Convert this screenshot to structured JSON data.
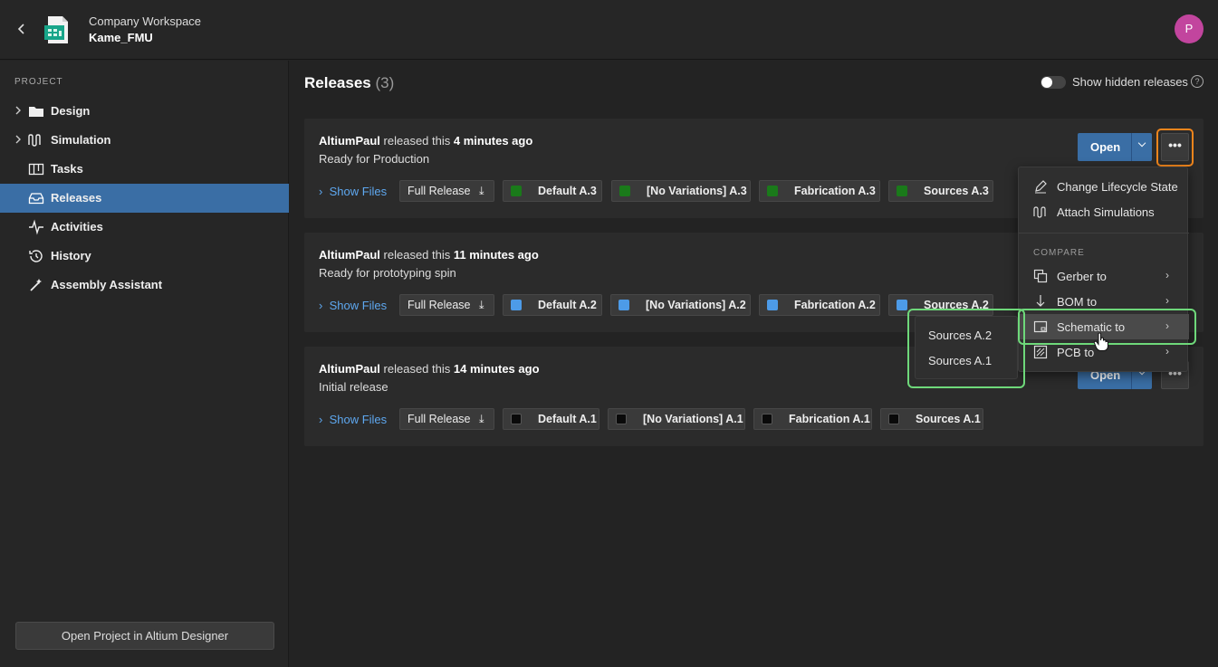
{
  "topbar": {
    "workspace": "Company Workspace",
    "project": "Kame_FMU",
    "avatar_initial": "P",
    "back_icon": "chevron-left-icon"
  },
  "sidebar": {
    "section": "PROJECT",
    "items": [
      {
        "label": "Design",
        "icon": "folder-icon",
        "expandable": true
      },
      {
        "label": "Simulation",
        "icon": "waveform-icon",
        "expandable": true
      },
      {
        "label": "Tasks",
        "icon": "board-icon",
        "expandable": false
      },
      {
        "label": "Releases",
        "icon": "inbox-icon",
        "expandable": false,
        "active": true
      },
      {
        "label": "Activities",
        "icon": "pulse-icon",
        "expandable": false
      },
      {
        "label": "History",
        "icon": "history-icon",
        "expandable": false
      },
      {
        "label": "Assembly Assistant",
        "icon": "wand-icon",
        "expandable": false
      }
    ],
    "open_button": "Open Project in Altium Designer"
  },
  "header": {
    "title": "Releases",
    "count": "(3)",
    "toggle_label": "Show hidden releases"
  },
  "releases": [
    {
      "user": "AltiumPaul",
      "verb": "released this",
      "time": "4 minutes ago",
      "note": "Ready for Production",
      "show_files": "Show Files",
      "full": "Full Release",
      "swatch": "#1a7a1a",
      "chips": [
        "Default A.3",
        "[No Variations] A.3",
        "Fabrication A.3",
        "Sources A.3"
      ]
    },
    {
      "user": "AltiumPaul",
      "verb": "released this",
      "time": "11 minutes ago",
      "note": "Ready for prototyping spin",
      "show_files": "Show Files",
      "full": "Full Release",
      "swatch": "#4d9be8",
      "chips": [
        "Default A.2",
        "[No Variations] A.2",
        "Fabrication A.2",
        "Sources A.2"
      ]
    },
    {
      "user": "AltiumPaul",
      "verb": "released this",
      "time": "14 minutes ago",
      "note": "Initial release",
      "show_files": "Show Files",
      "full": "Full Release",
      "swatch": "#0a0a0a",
      "chips": [
        "Default A.1",
        "[No Variations] A.1",
        "Fabrication A.1",
        "Sources A.1"
      ]
    }
  ],
  "open_label": "Open",
  "menu": {
    "items": [
      "Change Lifecycle State",
      "Attach Simulations"
    ],
    "compare_header": "COMPARE",
    "compare": [
      "Gerber to",
      "BOM to",
      "Schematic to",
      "PCB to"
    ]
  },
  "submenu": [
    "Sources A.2",
    "Sources A.1"
  ],
  "colors": {
    "accent": "#3a6ea5",
    "highlight_orange": "#f0851c",
    "highlight_green": "#6ed87a",
    "link": "#5ea8f0"
  }
}
